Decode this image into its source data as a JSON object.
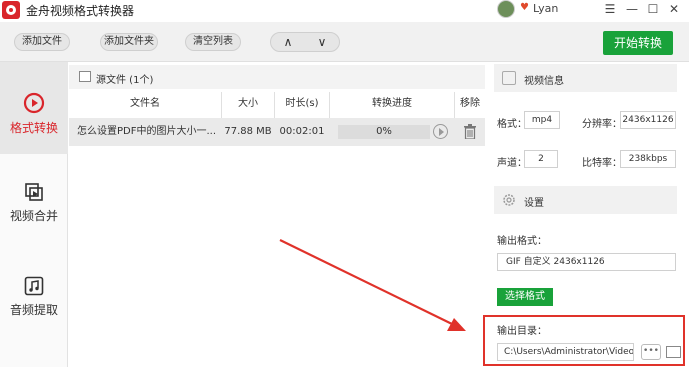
{
  "app": {
    "title": "金舟视频格式转换器"
  },
  "user": {
    "name": "Lyan"
  },
  "window_controls": {
    "menu": "☰",
    "minimize": "—",
    "maximize": "☐",
    "close": "✕"
  },
  "toolbar": {
    "add_file": "添加文件",
    "add_folder": "添加文件夹",
    "clear_list": "清空列表",
    "move_up": "∧",
    "move_down": "∨",
    "start": "开始转换"
  },
  "sidebar": {
    "items": [
      {
        "label": "格式转换",
        "icon": "play-circle-icon",
        "active": true
      },
      {
        "label": "视频合并",
        "icon": "merge-icon",
        "active": false
      },
      {
        "label": "音频提取",
        "icon": "music-note-icon",
        "active": false
      }
    ]
  },
  "files": {
    "title": "源文件 (1个)",
    "columns": {
      "name": "文件名",
      "size": "大小",
      "duration": "时长(s)",
      "progress": "转换进度",
      "remove": "移除"
    },
    "rows": [
      {
        "name": "怎么设置PDF中的图片大小一...",
        "size": "77.88 MB",
        "duration": "00:02:01",
        "progress": "0%"
      }
    ]
  },
  "video_info": {
    "title": "视频信息",
    "format_label": "格式：",
    "format_value": "mp4",
    "resolution_label": "分辨率：",
    "resolution_value": "2436x1126",
    "channels_label": "声道：",
    "channels_value": "2",
    "bitrate_label": "比特率：",
    "bitrate_value": "238kbps"
  },
  "settings": {
    "title": "设置",
    "output_format_label": "输出格式：",
    "output_format_value": "GIF 自定义 2436x1126",
    "choose_format": "选择格式",
    "output_dir_label": "输出目录：",
    "output_dir_value": "C:\\Users\\Administrator\\Videos\\",
    "more": "•••"
  },
  "colors": {
    "accent_red": "#d9252b",
    "accent_green": "#19a23a",
    "annotation_red": "#e0322a"
  }
}
